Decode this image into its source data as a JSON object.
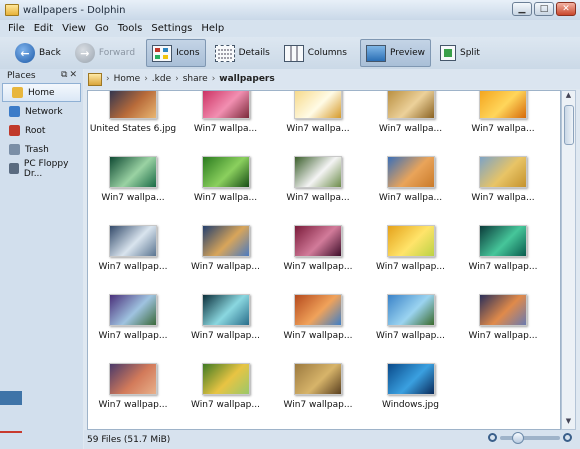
{
  "window": {
    "title": "wallpapers - Dolphin"
  },
  "menu": [
    "File",
    "Edit",
    "View",
    "Go",
    "Tools",
    "Settings",
    "Help"
  ],
  "toolbar": {
    "back": "Back",
    "forward": "Forward",
    "icons": "Icons",
    "details": "Details",
    "columns": "Columns",
    "preview": "Preview",
    "split": "Split"
  },
  "places": {
    "title": "Places",
    "items": [
      {
        "label": "Home",
        "icon": "home-icon",
        "color": "#e8b63c",
        "selected": true
      },
      {
        "label": "Network",
        "icon": "network-icon",
        "color": "#3b7bc8"
      },
      {
        "label": "Root",
        "icon": "root-icon",
        "color": "#c0392b"
      },
      {
        "label": "Trash",
        "icon": "trash-icon",
        "color": "#7a8ea6"
      },
      {
        "label": "PC Floppy Dr...",
        "icon": "floppy-icon",
        "color": "#5a6b80"
      }
    ]
  },
  "breadcrumb": {
    "parts": [
      "Home",
      ".kde",
      "share"
    ],
    "current": "wallpapers"
  },
  "files": [
    {
      "name": "United States 6.jpg",
      "colors": [
        "#2a3250",
        "#b86b3a",
        "#e9b672"
      ]
    },
    {
      "name": "Win7 wallpa...",
      "colors": [
        "#c92c5f",
        "#f28fb1",
        "#7a2a3a"
      ]
    },
    {
      "name": "Win7 wallpa...",
      "colors": [
        "#f6d784",
        "#fffbe6",
        "#d59a2b"
      ]
    },
    {
      "name": "Win7 wallpa...",
      "colors": [
        "#b68b3b",
        "#ecd19a",
        "#8a6222"
      ]
    },
    {
      "name": "Win7 wallpa...",
      "colors": [
        "#f3a21b",
        "#ffd65b",
        "#d66a0a"
      ]
    },
    {
      "name": "Win7 wallpa...",
      "colors": [
        "#0f4a33",
        "#9ad2a3",
        "#1a6b46"
      ]
    },
    {
      "name": "Win7 wallpa...",
      "colors": [
        "#2a7a1f",
        "#8bd05e",
        "#184e16"
      ]
    },
    {
      "name": "Win7 wallpa...",
      "colors": [
        "#3b5f2c",
        "#f4f4f4",
        "#6d8c4a"
      ]
    },
    {
      "name": "Win7 wallpa...",
      "colors": [
        "#3a6fb8",
        "#e9a45a",
        "#c97a2a"
      ]
    },
    {
      "name": "Win7 wallpa...",
      "colors": [
        "#7da3c6",
        "#e8c466",
        "#c4922d"
      ]
    },
    {
      "name": "Win7 wallpap...",
      "colors": [
        "#334a6a",
        "#d9e4ee",
        "#5a7490"
      ]
    },
    {
      "name": "Win7 wallpap...",
      "colors": [
        "#233f6e",
        "#d8a55a",
        "#4b7ac0"
      ]
    },
    {
      "name": "Win7 wallpap...",
      "colors": [
        "#7a1b3a",
        "#d27b9a",
        "#3e0e2a"
      ]
    },
    {
      "name": "Win7 wallpap...",
      "colors": [
        "#e5a21b",
        "#ffe46a",
        "#bbd244"
      ]
    },
    {
      "name": "Win7 wallpap...",
      "colors": [
        "#0b3a3a",
        "#46c69a",
        "#0a5c4e"
      ]
    },
    {
      "name": "Win7 wallpap...",
      "colors": [
        "#4a2f7a",
        "#9fc3e0",
        "#3b6a3a"
      ]
    },
    {
      "name": "Win7 wallpap...",
      "colors": [
        "#0c2f3a",
        "#8ad7e0",
        "#2a6d8a"
      ]
    },
    {
      "name": "Win7 wallpap...",
      "colors": [
        "#b54a1e",
        "#f0a25a",
        "#3f7fc6"
      ]
    },
    {
      "name": "Win7 wallpap...",
      "colors": [
        "#3a82c8",
        "#9bd4f0",
        "#3a6a2c"
      ]
    },
    {
      "name": "Win7 wallpap...",
      "colors": [
        "#2a2f5a",
        "#e08a4a",
        "#6a7ab0"
      ]
    },
    {
      "name": "Win7 wallpap...",
      "colors": [
        "#4a3a6a",
        "#d27a5a",
        "#e8b08a"
      ]
    },
    {
      "name": "Win7 wallpap...",
      "colors": [
        "#3f7a24",
        "#e8c443",
        "#9ac86a"
      ]
    },
    {
      "name": "Win7 wallpap...",
      "colors": [
        "#9c7a3f",
        "#d7b46a",
        "#5a4020"
      ]
    },
    {
      "name": "Windows.jpg",
      "colors": [
        "#0a4a8a",
        "#3aa0e0",
        "#0a2a5a"
      ]
    }
  ],
  "status": {
    "text": "59 Files (51.7 MiB)",
    "zoom_level": 0.3
  }
}
